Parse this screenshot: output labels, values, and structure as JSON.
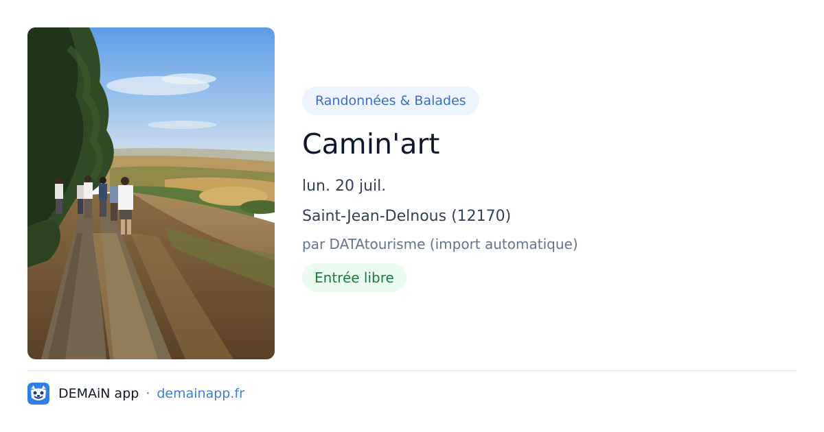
{
  "event": {
    "category": "Randonnées & Balades",
    "title": "Camin'art",
    "date": "lun. 20 juil.",
    "location": "Saint-Jean-Delnous (12170)",
    "source": "par DATAtourisme (import automatique)",
    "price": "Entrée libre"
  },
  "footer": {
    "app_name": "DEMAiN app",
    "separator": "·",
    "link": "demainapp.fr"
  },
  "icons": {
    "app_logo": "demain-app-logo-icon"
  },
  "colors": {
    "category_chip_bg": "#eef4fd",
    "category_chip_text": "#3b6fc4",
    "price_chip_bg": "#ecfbef",
    "price_chip_text": "#1f7a3a",
    "link": "#3b7ddd",
    "logo_blue": "#2f7fe8"
  }
}
